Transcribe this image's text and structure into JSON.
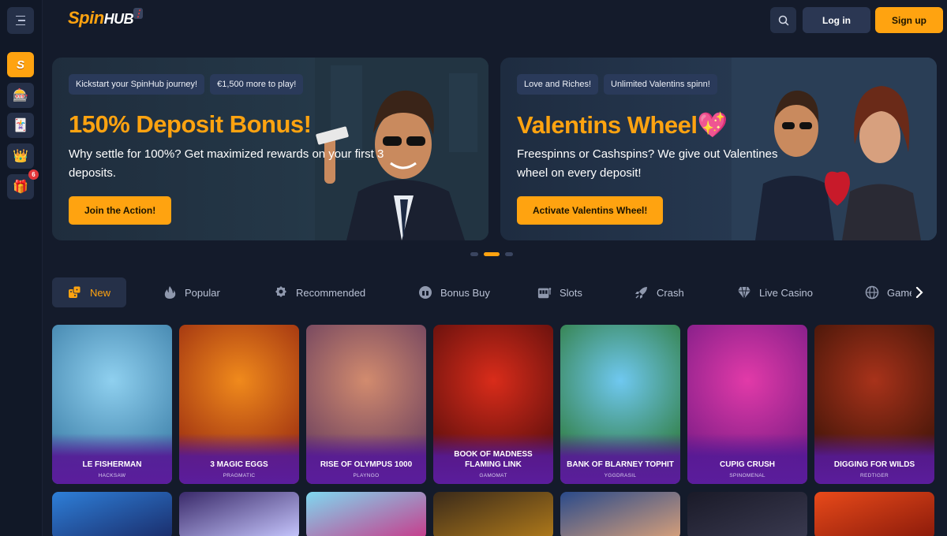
{
  "header": {
    "logo_spin": "Spin",
    "logo_hub": "HUB",
    "login_label": "Log in",
    "signup_label": "Sign up"
  },
  "rail": {
    "items": [
      {
        "icon": "spinhub-s-icon",
        "glyph": "S"
      },
      {
        "icon": "slot-machine-icon",
        "glyph": "🎰"
      },
      {
        "icon": "playing-cards-icon",
        "glyph": "🃏"
      },
      {
        "icon": "crown-icon",
        "glyph": "👑"
      },
      {
        "icon": "gift-icon",
        "glyph": "🎁",
        "badge": "6"
      }
    ]
  },
  "banners": [
    {
      "tags": [
        "Kickstart your SpinHub journey!",
        "€1,500 more to play!"
      ],
      "title": "150% Deposit Bonus!",
      "text": "Why settle for 100%? Get maximized rewards on your first 3 deposits.",
      "cta": "Join the Action!"
    },
    {
      "tags": [
        "Love and Riches!",
        "Unlimited Valentins spinn!"
      ],
      "title": "Valentins Wheel💖",
      "text": "Freespinns or Cashspins? We give out Valentines wheel on every deposit!",
      "cta": "Activate Valentins Wheel!"
    }
  ],
  "carousel": {
    "active_index": 1,
    "count": 3
  },
  "tabs": [
    {
      "label": "New",
      "icon": "dice-icon",
      "active": true
    },
    {
      "label": "Popular",
      "icon": "flame-icon"
    },
    {
      "label": "Recommended",
      "icon": "badge-icon"
    },
    {
      "label": "Bonus Buy",
      "icon": "bonus-icon"
    },
    {
      "label": "Slots",
      "icon": "slot-icon"
    },
    {
      "label": "Crash",
      "icon": "rocket-icon"
    },
    {
      "label": "Live Casino",
      "icon": "diamond-icon"
    },
    {
      "label": "Game",
      "icon": "globe-icon"
    }
  ],
  "games": [
    {
      "name": "LE FISHERMAN",
      "provider": "HACKSAW",
      "art_title": "",
      "colors": [
        "#8fd0ef",
        "#3d7fa8"
      ]
    },
    {
      "name": "3 MAGIC EGGS",
      "provider": "PRAGMATIC",
      "art_title": "",
      "colors": [
        "#f08a1c",
        "#9a2c10"
      ]
    },
    {
      "name": "RISE OF OLYMPUS 1000",
      "provider": "PLAYNGO",
      "art_title": "",
      "colors": [
        "#d28b6e",
        "#6a3f5e"
      ]
    },
    {
      "name": "BOOK OF MADNESS FLAMING LINK",
      "provider": "GAMOMAT",
      "art_title": "",
      "colors": [
        "#d92c1a",
        "#5a0e0c"
      ]
    },
    {
      "name": "BANK OF BLARNEY TOPHIT",
      "provider": "YGGDRASIL",
      "art_title": "",
      "colors": [
        "#6fc8f0",
        "#2e7a3a"
      ]
    },
    {
      "name": "CUPIG CRUSH",
      "provider": "SPINOMENAL",
      "art_title": "",
      "colors": [
        "#e23aa8",
        "#7a1c86"
      ]
    },
    {
      "name": "DIGGING FOR WILDS",
      "provider": "REDTIGER",
      "art_title": "",
      "colors": [
        "#a8321a",
        "#3e1408"
      ]
    }
  ],
  "games_row2_colors": [
    [
      "#2e7fd8",
      "#1a2c6a"
    ],
    [
      "#3a2a6a",
      "#c8c8ff"
    ],
    [
      "#7fd8f0",
      "#c83a8a"
    ],
    [
      "#3a2a1a",
      "#b07a1a"
    ],
    [
      "#2a4a8a",
      "#d8a07a"
    ],
    [
      "#1a1a28",
      "#3a3a50"
    ],
    [
      "#e84a1a",
      "#8a1a0a"
    ]
  ]
}
